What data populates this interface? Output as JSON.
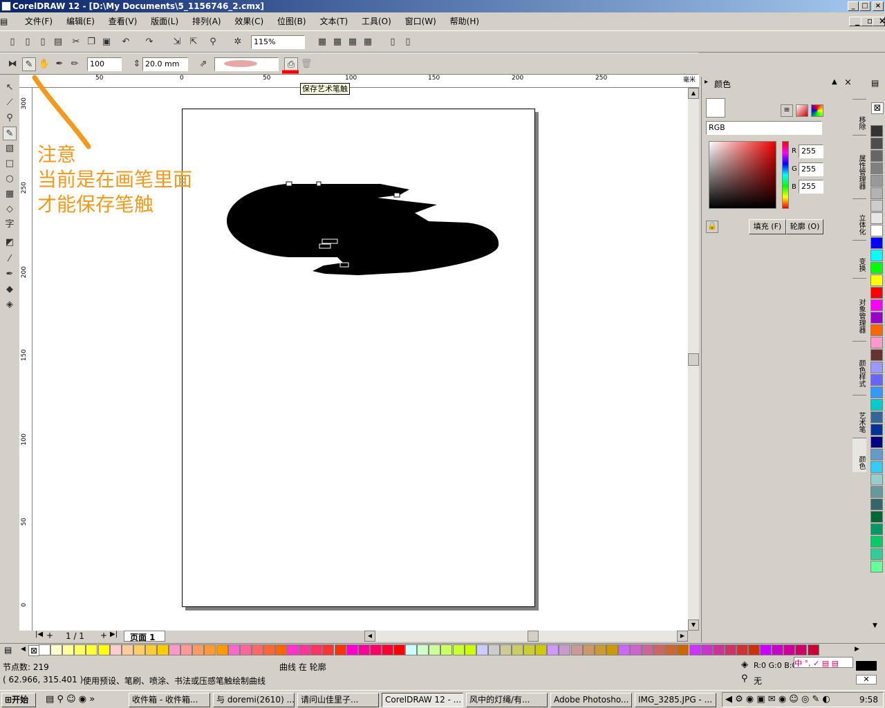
{
  "window": {
    "title": "CorelDRAW 12 - [D:\\My Documents\\5_1156746_2.cmx]"
  },
  "menu": [
    "文件(F)",
    "编辑(E)",
    "查看(V)",
    "版面(L)",
    "排列(A)",
    "效果(C)",
    "位图(B)",
    "文本(T)",
    "工具(O)",
    "窗口(W)",
    "帮助(H)"
  ],
  "toolbar": {
    "zoom": "115%",
    "width_value": "100",
    "stroke_width": "20.0 mm"
  },
  "tooltip": "保存艺术笔触",
  "note": {
    "line1": "注意",
    "line2": "当前是在画笔里面",
    "line3": "才能保存笔触"
  },
  "ruler": {
    "h_labels": [
      "50",
      "0",
      "50",
      "100",
      "150",
      "200",
      "250"
    ],
    "unit": "毫米",
    "v_labels": [
      "300",
      "250",
      "200",
      "150",
      "100",
      "50",
      "0"
    ]
  },
  "page_nav": {
    "count": "1 / 1",
    "tab": "页面 1"
  },
  "docker": {
    "title": "颜色",
    "model": "RGB",
    "r_label": "R",
    "g_label": "G",
    "b_label": "B",
    "r": "255",
    "g": "255",
    "b": "255",
    "fill_button": "填充 (F)",
    "outline_button": "轮廓 (O)"
  },
  "side_tabs": [
    "移除",
    "属性管理器",
    "立体化",
    "变换",
    "对象管理器",
    "颜色样式",
    "艺术笔",
    "颜色"
  ],
  "status": {
    "nodes": "节点数: 219",
    "object": "曲线 在 轮廓",
    "coords": "( 62.966, 315.401 )",
    "hint": "使用预设、笔刷、喷涂、书法或压感笔触绘制曲线",
    "fill_info": "R:0 G:0 B:0",
    "outline_info": "无"
  },
  "taskbar": {
    "start": "开始",
    "tasks": [
      "收件箱 - 收件箱...",
      "与 doremi(2610) ...",
      "请问山佳里子...",
      "CorelDRAW 12 - ...",
      "风中的灯绳/有...",
      "Adobe Photosho...",
      "IMG_3285.JPG - ..."
    ],
    "clock": "9:58"
  },
  "palette_right": [
    "#000000",
    "#1a1a1a",
    "#333333",
    "#4d4d4d",
    "#666666",
    "#808080",
    "#999999",
    "#b3b3b3",
    "#cccccc",
    "#e6e6e6",
    "#ffffff",
    "#0000ff",
    "#00ffff",
    "#00ff00",
    "#ffff00",
    "#ff0000",
    "#ff00ff",
    "#9900cc",
    "#ff6600",
    "#ff99cc",
    "#663333",
    "#9999ff",
    "#6666ff",
    "#3399ff",
    "#00cccc",
    "#336699",
    "#003399",
    "#000080",
    "#6699cc",
    "#33ccff",
    "#99cccc",
    "#669999",
    "#336666",
    "#006633",
    "#009966",
    "#00cc66",
    "#33cc99",
    "#66ff99"
  ],
  "palette_bottom": [
    "#ffffff",
    "#ffffcc",
    "#ffff99",
    "#ffff66",
    "#ffff33",
    "#ffff00",
    "#ffcccc",
    "#ffcc99",
    "#ffcc66",
    "#ffcc33",
    "#ffcc00",
    "#ff99cc",
    "#ff9999",
    "#ff9966",
    "#ff9933",
    "#ff9900",
    "#ff66cc",
    "#ff6699",
    "#ff6666",
    "#ff6633",
    "#ff6600",
    "#ff33cc",
    "#ff3399",
    "#ff3366",
    "#ff3333",
    "#ff3300",
    "#ff00cc",
    "#ff0099",
    "#ff0066",
    "#ff0033",
    "#ff0000",
    "#ccffff",
    "#ccffcc",
    "#ccff99",
    "#ccff66",
    "#ccff33",
    "#ccff00",
    "#ccccff",
    "#cccccc",
    "#cccc99",
    "#cccc66",
    "#cccc33",
    "#cccc00",
    "#cc99ff",
    "#cc99cc",
    "#cc9999",
    "#cc9966",
    "#cc9933",
    "#cc9900",
    "#cc66ff",
    "#cc66cc",
    "#cc6699",
    "#cc6666",
    "#cc6633",
    "#cc6600",
    "#cc33ff",
    "#cc33cc",
    "#cc3399",
    "#cc3366",
    "#cc3333",
    "#cc3300",
    "#cc00ff",
    "#cc00cc",
    "#cc0099",
    "#cc0066",
    "#cc0033"
  ]
}
